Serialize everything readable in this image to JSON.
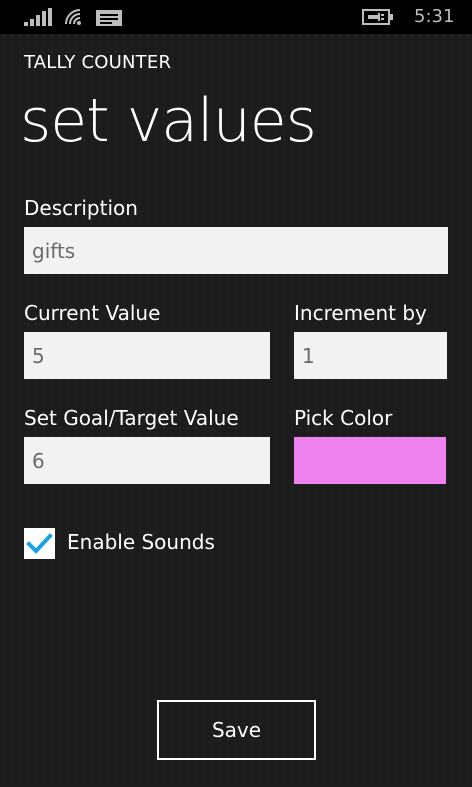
{
  "status_bar": {
    "time": "5:31",
    "icons": [
      "signal-icon",
      "wifi-icon",
      "message-icon",
      "battery-charging-icon"
    ]
  },
  "app": {
    "title": "TALLY COUNTER",
    "page_title": "set values"
  },
  "form": {
    "description_label": "Description",
    "description_value": "gifts",
    "current_value_label": "Current Value",
    "current_value": "5",
    "increment_label": "Increment by",
    "increment_value": "1",
    "goal_label": "Set Goal/Target Value",
    "goal_value": "6",
    "color_label": "Pick Color",
    "picked_color": "#ee82ee",
    "enable_sounds_label": "Enable Sounds",
    "enable_sounds_checked": true
  },
  "actions": {
    "save_label": "Save"
  },
  "colors": {
    "background": "#1c1c1c",
    "accent": "#1ba1e2",
    "field_bg": "#f2f2f2"
  }
}
